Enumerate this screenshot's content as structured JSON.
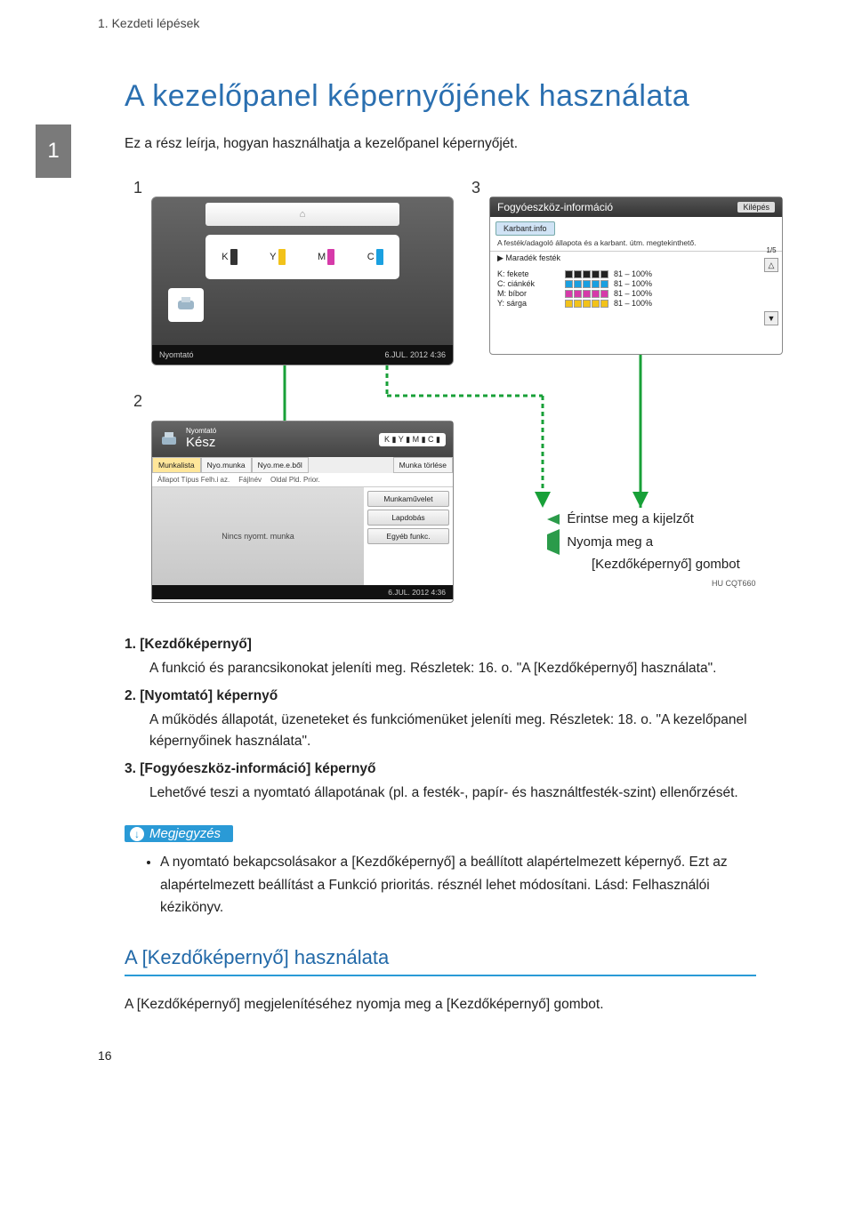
{
  "header": {
    "breadcrumb": "1. Kezdeti lépések"
  },
  "chapter_tab": "1",
  "title": "A kezelőpanel képernyőjének használata",
  "intro": "Ez a rész leírja, hogyan használhatja a kezelőpanel képernyőjét.",
  "callouts": {
    "c1": "1",
    "c2": "2",
    "c3": "3"
  },
  "panel1": {
    "home_icon": "⌂",
    "kymc": [
      "K",
      "Y",
      "M",
      "C"
    ],
    "printer_label": "Nyomtató",
    "clock": "6.JUL. 2012  4:36"
  },
  "panel3": {
    "title": "Fogyóeszköz-információ",
    "exit": "Kilépés",
    "maint_btn": "Karbant.info",
    "desc": "A festék/adagoló állapota és a karbant. útm. megtekinthető.",
    "sub_left": "▶ Maradék festék",
    "page": "1/5",
    "rows": [
      {
        "label": "K: fekete",
        "color": "#222",
        "pct": "81 – 100%"
      },
      {
        "label": "C: ciánkék",
        "color": "#1aa0e0",
        "pct": "81 – 100%"
      },
      {
        "label": "M: bíbor",
        "color": "#d63aa9",
        "pct": "81 – 100%"
      },
      {
        "label": "Y: sárga",
        "color": "#f2c21a",
        "pct": "81 – 100%"
      }
    ],
    "tri_up": "△",
    "tri_down": "▼"
  },
  "panel2": {
    "icon_label": "Nyomtató",
    "ready": "Kész",
    "kymc": [
      "K",
      "Y",
      "M",
      "C"
    ],
    "tabs": [
      "Munkalista",
      "Nyo.munka",
      "Nyo.me.e.ből"
    ],
    "del_btn": "Munka törlése",
    "row2": [
      "Állapot Típus Felh.i az.",
      "Fájlnév",
      "Oldal Pld. Prior."
    ],
    "empty": "Nincs nyomt. munka",
    "side_btns": [
      "Munkaművelet",
      "Lapdobás",
      "Egyéb funkc."
    ],
    "clock": "6.JUL. 2012  4:36"
  },
  "legend": {
    "touch": "Érintse meg a kijelzőt",
    "press": "Nyomja meg a",
    "press2": "[Kezdőképernyő] gombot"
  },
  "refcode": "HU CQT660",
  "items": [
    {
      "num": "1.",
      "head": "[Kezdőképernyő]",
      "body": "A funkció és parancsikonokat jeleníti meg. Részletek: 16. o. \"A [Kezdőképernyő] használata\"."
    },
    {
      "num": "2.",
      "head": "[Nyomtató] képernyő",
      "body": "A működés állapotát, üzeneteket és funkciómenüket jeleníti meg. Részletek: 18. o. \"A kezelőpanel képernyőinek használata\"."
    },
    {
      "num": "3.",
      "head": "[Fogyóeszköz-információ] képernyő",
      "body": "Lehetővé teszi a nyomtató állapotának (pl. a festék-, papír- és használtfesték-szint) ellenőrzését."
    }
  ],
  "note_label": "Megjegyzés",
  "note_bullet": "A nyomtató bekapcsolásakor a [Kezdőképernyő] a beállított alapértelmezett képernyő. Ezt az alapértelmezett beállítást a Funkció prioritás. résznél lehet módosítani. Lásd: Felhasználói kézikönyv.",
  "section_h2": "A [Kezdőképernyő] használata",
  "section_p": "A [Kezdőképernyő] megjelenítéséhez nyomja meg a [Kezdőképernyő] gombot.",
  "page_number": "16"
}
